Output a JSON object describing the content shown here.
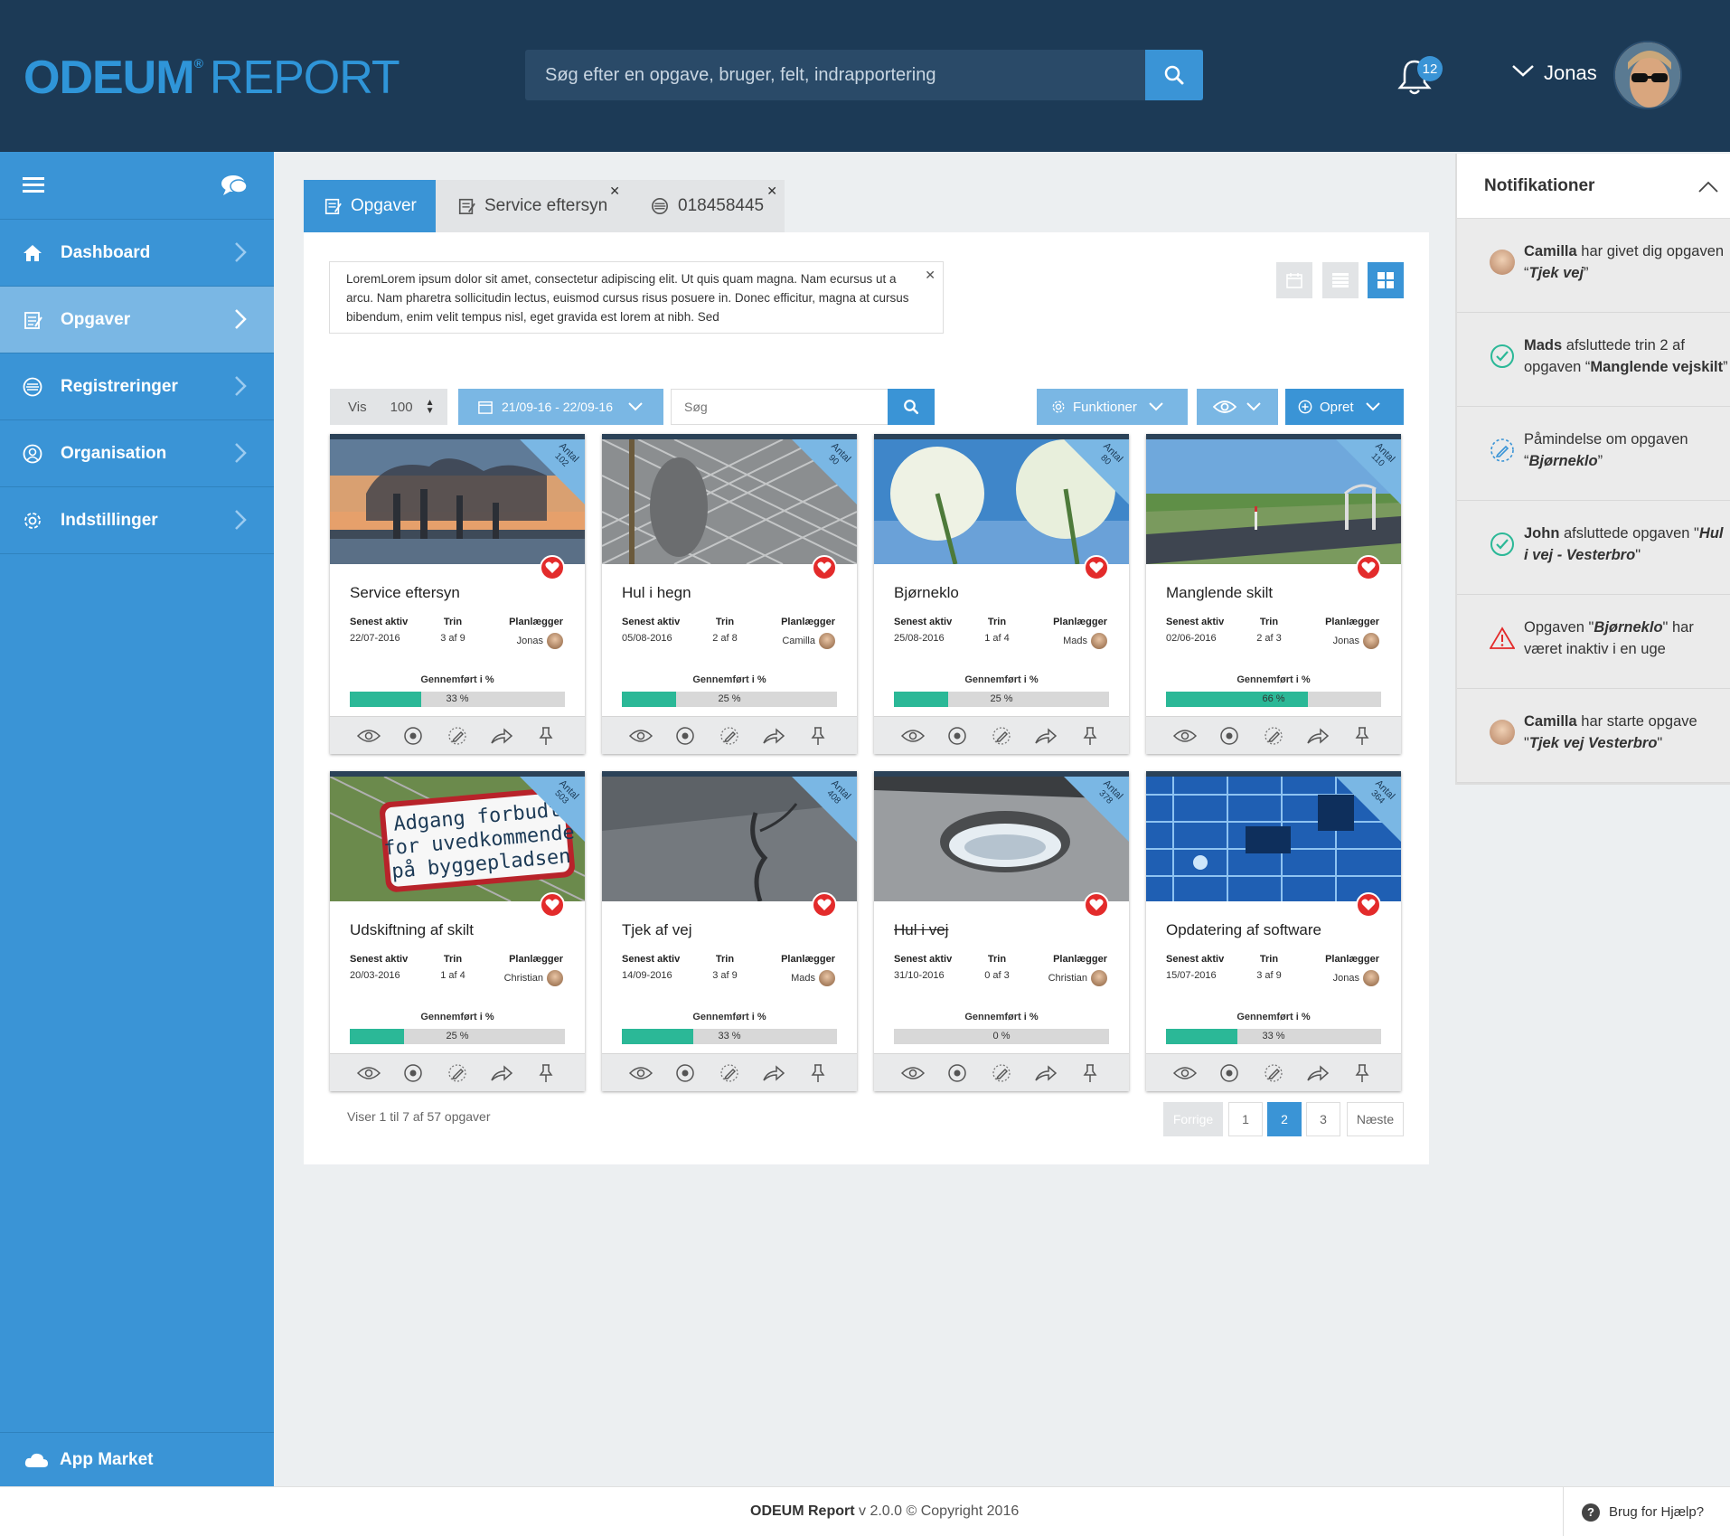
{
  "header": {
    "logo_main": "ODEUM",
    "logo_reg": "®",
    "logo_sub": "REPORT",
    "search_placeholder": "Søg efter en opgave, bruger, felt, indrapportering",
    "notification_count": "12",
    "user_name": "Jonas"
  },
  "sidebar": {
    "items": [
      {
        "label": "Dashboard",
        "icon": "home-icon"
      },
      {
        "label": "Opgaver",
        "icon": "tasks-icon",
        "active": true
      },
      {
        "label": "Registreringer",
        "icon": "list-icon"
      },
      {
        "label": "Organisation",
        "icon": "user-icon"
      },
      {
        "label": "Indstillinger",
        "icon": "gear-icon"
      }
    ],
    "app_market": "App Market"
  },
  "tabs": [
    {
      "label": "Opgaver"
    },
    {
      "label": "Service eftersyn"
    },
    {
      "label": "018458445"
    }
  ],
  "info_text": "LoremLorem ipsum dolor sit amet, consectetur adipiscing elit. Ut quis quam magna. Nam ecursus ut a arcu. Nam pharetra sollicitudin lectus, euismod cursus risus posuere in. Donec efficitur, magna at cursus bibendum, enim velit tempus nisl, eget gravida est lorem at nibh. Sed",
  "toolbar": {
    "vis_label": "Vis",
    "vis_value": "100",
    "date_range": "21/09-16 - 22/09-16",
    "search_placeholder": "Søg",
    "functions_label": "Funktioner",
    "create_label": "Opret"
  },
  "labels": {
    "last_active": "Senest aktiv",
    "step": "Trin",
    "planner": "Planlægger",
    "completed": "Gennemført i %",
    "antal": "Antal"
  },
  "cards": [
    {
      "title": "Service eftersyn",
      "count": "102",
      "last_active": "22/07-2016",
      "step": "3 af 9",
      "planner": "Jonas",
      "progress": 33,
      "progress_label": "33 %",
      "strike": false
    },
    {
      "title": "Hul i hegn",
      "count": "90",
      "last_active": "05/08-2016",
      "step": "2 af 8",
      "planner": "Camilla",
      "progress": 25,
      "progress_label": "25 %",
      "strike": false
    },
    {
      "title": "Bjørneklo",
      "count": "80",
      "last_active": "25/08-2016",
      "step": "1 af 4",
      "planner": "Mads",
      "progress": 25,
      "progress_label": "25 %",
      "strike": false
    },
    {
      "title": "Manglende skilt",
      "count": "110",
      "last_active": "02/06-2016",
      "step": "2 af 3",
      "planner": "Jonas",
      "progress": 66,
      "progress_label": "66 %",
      "strike": false
    },
    {
      "title": "Udskiftning af skilt",
      "count": "503",
      "last_active": "20/03-2016",
      "step": "1 af 4",
      "planner": "Christian",
      "progress": 25,
      "progress_label": "25 %",
      "strike": false
    },
    {
      "title": "Tjek af vej",
      "count": "408",
      "last_active": "14/09-2016",
      "step": "3 af 9",
      "planner": "Mads",
      "progress": 33,
      "progress_label": "33 %",
      "strike": false
    },
    {
      "title": "Hul i vej",
      "count": "378",
      "last_active": "31/10-2016",
      "step": "0 af 3",
      "planner": "Christian",
      "progress": 0,
      "progress_label": "0 %",
      "strike": true
    },
    {
      "title": "Opdatering af software",
      "count": "364",
      "last_active": "15/07-2016",
      "step": "3 af 9",
      "planner": "Jonas",
      "progress": 33,
      "progress_label": "33 %",
      "strike": false
    }
  ],
  "sign_text": {
    "line1": "Adgang forbudt",
    "line2": "for uvedkommende",
    "line3": "på byggepladsen"
  },
  "pagination": {
    "info": "Viser 1 til 7 af 57 opgaver",
    "prev": "Forrige",
    "pages": [
      "1",
      "2",
      "3"
    ],
    "current": "2",
    "next": "Næste"
  },
  "notifications": {
    "title": "Notifikationer",
    "items": [
      {
        "type": "avatar",
        "bold": "Camilla",
        "text": " har givet dig opgaven “",
        "italic": "Tjek vej",
        "end": "”"
      },
      {
        "type": "check",
        "bold": "Mads",
        "text": " afsluttede trin 2 af opgaven “",
        "italic": "",
        "boldtail": "Manglende vejskilt",
        "end": "”"
      },
      {
        "type": "pencil",
        "bold": "",
        "text": "Påmindelse om opgaven “",
        "italic": "Bjørneklo",
        "end": "”"
      },
      {
        "type": "check",
        "bold": "John",
        "text": " afsluttede opgaven \"",
        "italic": "Hul i vej - Vesterbro",
        "end": "\""
      },
      {
        "type": "warning",
        "bold": "",
        "text": "Opgaven \"",
        "italic": "Bjørneklo",
        "end": "\" har været inaktiv i en uge"
      },
      {
        "type": "avatar",
        "bold": "Camilla",
        "text": " har starte opgave \"",
        "italic": "Tjek vej Vesterbro",
        "end": "\""
      }
    ]
  },
  "footer": {
    "brand": "ODEUM Report",
    "text": " v 2.0.0 © Copyright 2016",
    "help": "Brug for Hjælp?"
  },
  "colors": {
    "header_bg": "#1c3a56",
    "primary": "#3a94d6",
    "primary_light": "#7ab7e4",
    "progress": "#2bb897",
    "heart": "#e32b2b"
  }
}
